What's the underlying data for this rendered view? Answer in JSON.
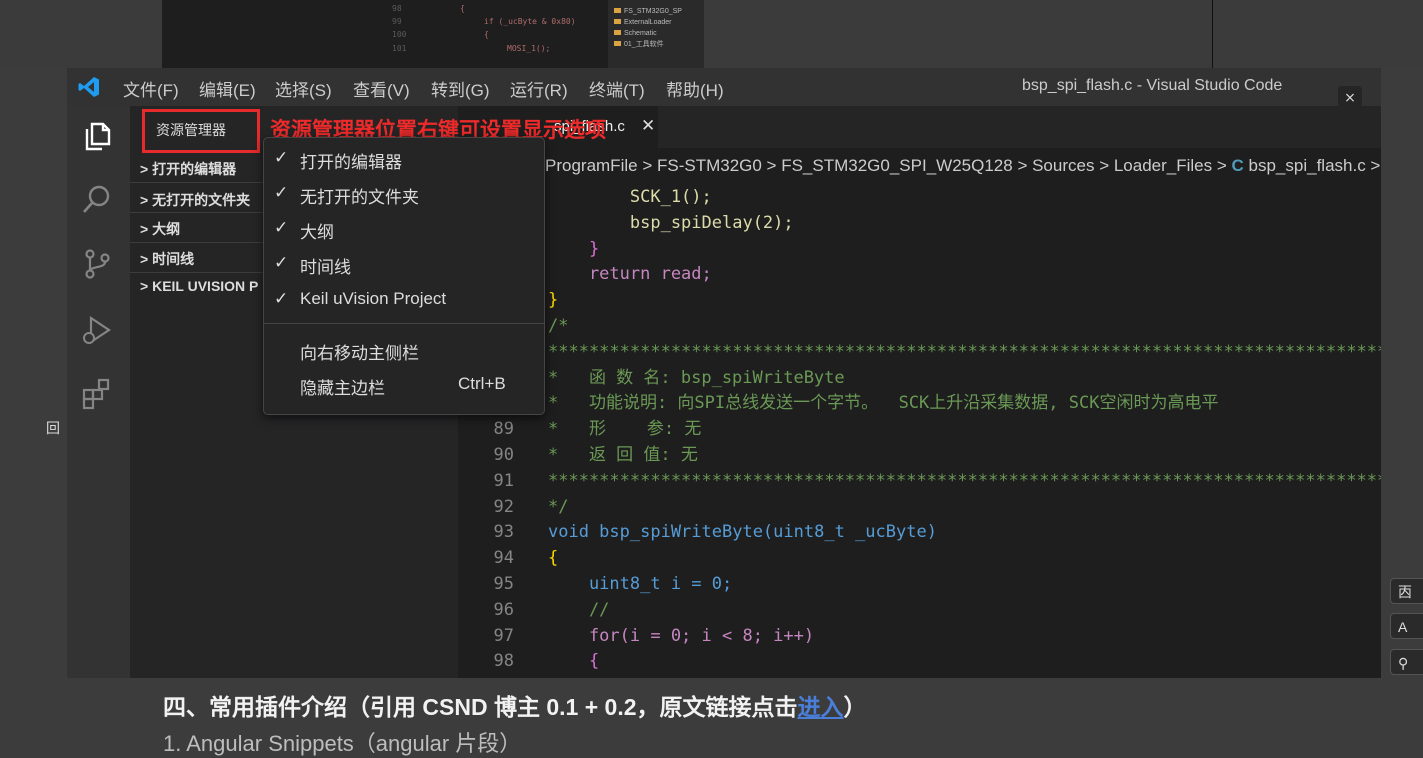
{
  "background": {
    "code_lines": [
      {
        "num": "98",
        "text": "{"
      },
      {
        "num": "99",
        "text": "if (_ucByte & 0x80)"
      },
      {
        "num": "100",
        "text": "{"
      },
      {
        "num": "101",
        "text": "MOSI_1();"
      }
    ],
    "tree_items": [
      "FS_STM32G0_SP",
      "ExternalLoader",
      "Schematic",
      "01_工具软件"
    ],
    "article_heading_text": "四、常用插件介绍（引用 CSND 博主 0.1 + 0.2，原文链接点击",
    "article_heading_link": "进入",
    "article_heading_end": "）",
    "article_sub": "1. Angular Snippets（angular 片段）",
    "left_glyph": "回",
    "side_tools": [
      "㐁",
      "A",
      "⚲"
    ]
  },
  "window": {
    "menus": [
      "文件(F)",
      "编辑(E)",
      "选择(S)",
      "查看(V)",
      "转到(G)",
      "运行(R)",
      "终端(T)",
      "帮助(H)"
    ],
    "title": "bsp_spi_flash.c - Visual Studio Code",
    "close_icon": "⨯"
  },
  "sidebar": {
    "title": "资源管理器",
    "sections": [
      "打开的编辑器",
      "无打开的文件夹",
      "大纲",
      "时间线",
      "KEIL UVISION P"
    ]
  },
  "annotation": "资源管理器位置右键可设置显示选项",
  "context_menu": {
    "items": [
      {
        "check": "✓",
        "label": "打开的编辑器"
      },
      {
        "check": "✓",
        "label": "无打开的文件夹"
      },
      {
        "check": "✓",
        "label": "大纲"
      },
      {
        "check": "✓",
        "label": "时间线"
      },
      {
        "check": "✓",
        "label": "Keil uVision Project"
      }
    ],
    "actions": [
      {
        "label": "向右移动主侧栏",
        "shortcut": ""
      },
      {
        "label": "隐藏主边栏",
        "shortcut": "Ctrl+B"
      }
    ]
  },
  "editor": {
    "tab": "spi_flash.c",
    "breadcrumb": [
      "ProgramFile",
      "FS-STM32G0",
      "FS_STM32G0_SPI_W25Q128",
      "Sources",
      "Loader_Files",
      "bsp_spi_flash.c",
      "..."
    ],
    "code": [
      {
        "num": "",
        "text": "        SCK_1();"
      },
      {
        "num": "",
        "text": "        bsp_spiDelay(2);"
      },
      {
        "num": "",
        "text": "    }"
      },
      {
        "num": "",
        "text": "    return read;"
      },
      {
        "num": "",
        "text": "}"
      },
      {
        "num": "",
        "text": "/*"
      },
      {
        "num": "",
        "text": "***********************************************************************************************"
      },
      {
        "num": "",
        "text": "*   函 数 名: bsp_spiWriteByte"
      },
      {
        "num": "",
        "text": "*   功能说明: 向SPI总线发送一个字节。  SCK上升沿采集数据, SCK空闲时为高电平"
      },
      {
        "num": "89",
        "text": "*   形    参: 无"
      },
      {
        "num": "90",
        "text": "*   返 回 值: 无"
      },
      {
        "num": "91",
        "text": "***********************************************************************************************"
      },
      {
        "num": "92",
        "text": "*/"
      },
      {
        "num": "93",
        "text": "void bsp_spiWriteByte(uint8_t _ucByte)"
      },
      {
        "num": "94",
        "text": "{"
      },
      {
        "num": "95",
        "text": "    uint8_t i = 0;"
      },
      {
        "num": "96",
        "text": "    //"
      },
      {
        "num": "97",
        "text": "    for(i = 0; i < 8; i++)"
      },
      {
        "num": "98",
        "text": "    {"
      }
    ]
  }
}
